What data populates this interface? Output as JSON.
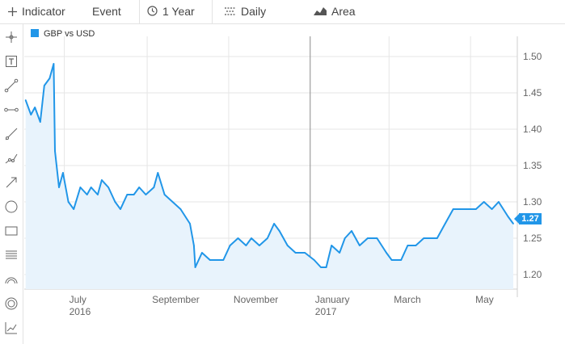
{
  "toolbar": {
    "indicator_label": "Indicator",
    "event_label": "Event",
    "period_label": "1 Year",
    "interval_label": "Daily",
    "charttype_label": "Area"
  },
  "sidebar": {
    "tools": [
      "crosshair",
      "text",
      "line-segment",
      "horizontal-segment",
      "trend-line",
      "polyline",
      "arrow",
      "circle",
      "rectangle",
      "fibonacci",
      "arc",
      "concentric-circles",
      "chart-settings"
    ]
  },
  "colors": {
    "series": "#2196e8",
    "fill": "#e8f3fc",
    "grid": "#e6e6e6",
    "today_line": "#8a8a8a"
  },
  "chart_data": {
    "type": "area",
    "title": "",
    "legend": "GBP vs USD",
    "series": [
      {
        "name": "GBP vs USD",
        "x": [
          "2016-06-02",
          "2016-06-06",
          "2016-06-09",
          "2016-06-13",
          "2016-06-16",
          "2016-06-20",
          "2016-06-23",
          "2016-06-24",
          "2016-06-27",
          "2016-06-30",
          "2016-07-04",
          "2016-07-08",
          "2016-07-13",
          "2016-07-18",
          "2016-07-21",
          "2016-07-26",
          "2016-07-29",
          "2016-08-03",
          "2016-08-08",
          "2016-08-12",
          "2016-08-17",
          "2016-08-22",
          "2016-08-26",
          "2016-08-31",
          "2016-09-06",
          "2016-09-09",
          "2016-09-14",
          "2016-09-20",
          "2016-09-26",
          "2016-10-03",
          "2016-10-06",
          "2016-10-07",
          "2016-10-12",
          "2016-10-18",
          "2016-10-24",
          "2016-10-28",
          "2016-11-02",
          "2016-11-08",
          "2016-11-14",
          "2016-11-18",
          "2016-11-24",
          "2016-11-30",
          "2016-12-05",
          "2016-12-09",
          "2016-12-15",
          "2016-12-21",
          "2016-12-28",
          "2017-01-04",
          "2017-01-09",
          "2017-01-13",
          "2017-01-17",
          "2017-01-23",
          "2017-01-27",
          "2017-02-01",
          "2017-02-07",
          "2017-02-13",
          "2017-02-20",
          "2017-02-27",
          "2017-03-03",
          "2017-03-10",
          "2017-03-15",
          "2017-03-21",
          "2017-03-27",
          "2017-03-31",
          "2017-04-06",
          "2017-04-12",
          "2017-04-18",
          "2017-04-24",
          "2017-04-28",
          "2017-05-05",
          "2017-05-11",
          "2017-05-17",
          "2017-05-22",
          "2017-05-29",
          "2017-06-02"
        ],
        "values": [
          1.44,
          1.42,
          1.43,
          1.41,
          1.46,
          1.47,
          1.49,
          1.37,
          1.32,
          1.34,
          1.3,
          1.29,
          1.32,
          1.31,
          1.32,
          1.31,
          1.33,
          1.32,
          1.3,
          1.29,
          1.31,
          1.31,
          1.32,
          1.31,
          1.32,
          1.34,
          1.31,
          1.3,
          1.29,
          1.27,
          1.24,
          1.21,
          1.23,
          1.22,
          1.22,
          1.22,
          1.24,
          1.25,
          1.24,
          1.25,
          1.24,
          1.25,
          1.27,
          1.26,
          1.24,
          1.23,
          1.23,
          1.22,
          1.21,
          1.21,
          1.24,
          1.23,
          1.25,
          1.26,
          1.24,
          1.25,
          1.25,
          1.23,
          1.22,
          1.22,
          1.24,
          1.24,
          1.25,
          1.25,
          1.25,
          1.27,
          1.29,
          1.29,
          1.29,
          1.29,
          1.3,
          1.29,
          1.3,
          1.28,
          1.27
        ]
      }
    ],
    "ylim": [
      1.18,
      1.52
    ],
    "yticks": [
      1.2,
      1.25,
      1.3,
      1.35,
      1.4,
      1.45,
      1.5
    ],
    "xticks": [
      {
        "date": "2016-07-01",
        "label": "July",
        "sublabel": "2016"
      },
      {
        "date": "2016-09-01",
        "label": "September",
        "sublabel": ""
      },
      {
        "date": "2016-11-01",
        "label": "November",
        "sublabel": ""
      },
      {
        "date": "2017-01-01",
        "label": "January",
        "sublabel": "2017"
      },
      {
        "date": "2017-03-01",
        "label": "March",
        "sublabel": ""
      },
      {
        "date": "2017-05-01",
        "label": "May",
        "sublabel": ""
      }
    ],
    "xlim": [
      "2016-06-01",
      "2017-06-05"
    ],
    "last_value_label": "1.27",
    "grid": true,
    "legend_position": "top-left"
  }
}
